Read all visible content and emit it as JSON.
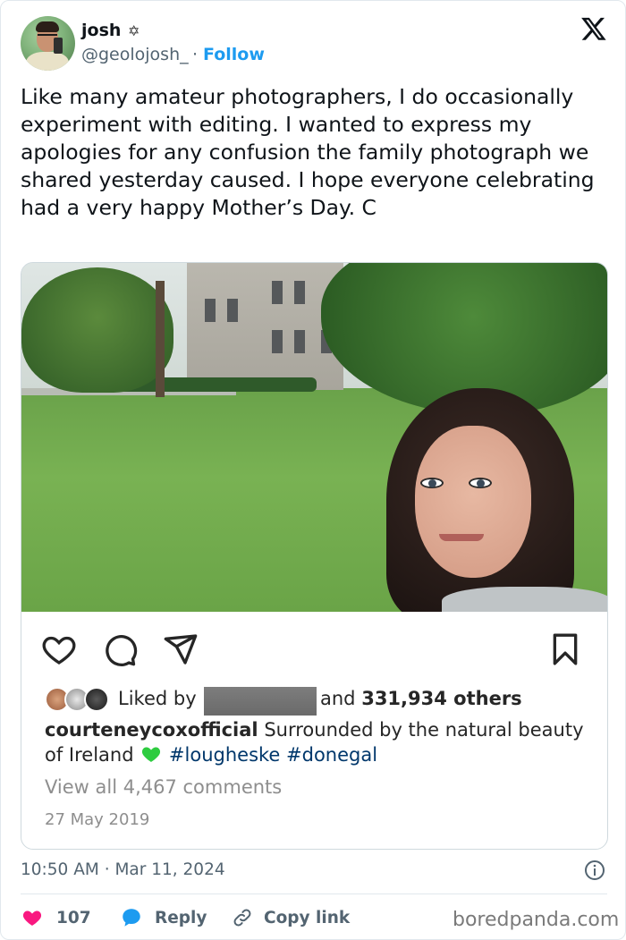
{
  "author": {
    "name": "josh",
    "badge": "✡",
    "handle": "@geolojosh_",
    "separator": "·",
    "follow_label": "Follow"
  },
  "tweet": {
    "text": "Like many amateur photographers, I do occasionally experiment with editing. I wanted to express my apologies for any confusion the family photograph we shared yesterday caused. I hope everyone celebrating had a very happy Mother’s Day. C"
  },
  "embed": {
    "liked_prefix": "Liked by",
    "liked_suffix_prefix": "and",
    "liked_count": "331,934 others",
    "caption_user": "courteneycoxofficial",
    "caption_text": "Surrounded by the natural beauty of Ireland",
    "tags": [
      "#lougheske",
      "#donegal"
    ],
    "view_comments": "View all 4,467 comments",
    "post_date": "27 May 2019"
  },
  "meta": {
    "timestamp": "10:50 AM · Mar 11, 2024"
  },
  "footer": {
    "like_count": "107",
    "reply_label": "Reply",
    "copy_link_label": "Copy link"
  },
  "watermark": "boredpanda.com",
  "colors": {
    "accent": "#1d9bf0",
    "like": "#f91880",
    "tag": "#00376b",
    "green_heart": "#2ecc40"
  }
}
